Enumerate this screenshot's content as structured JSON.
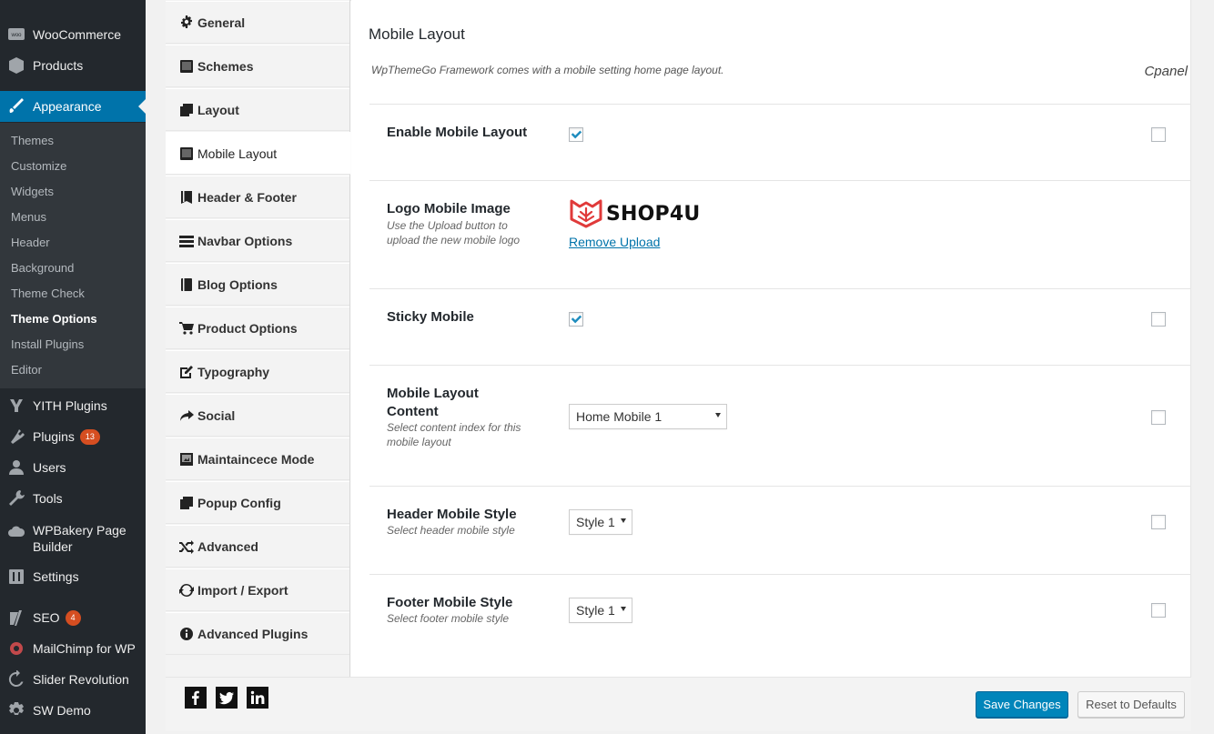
{
  "admin_menu": {
    "items_top": [
      {
        "label": "WooCommerce",
        "icon": "woo-icon"
      },
      {
        "label": "Products",
        "icon": "box-icon"
      },
      {
        "label": "Appearance",
        "icon": "paintbrush-icon"
      }
    ],
    "submenu": [
      "Themes",
      "Customize",
      "Widgets",
      "Menus",
      "Header",
      "Background",
      "Theme Check",
      "Theme Options",
      "Install Plugins",
      "Editor"
    ],
    "current_submenu": "Theme Options",
    "items_bottom": [
      {
        "label": "YITH Plugins",
        "icon": "yith-icon"
      },
      {
        "label": "Plugins",
        "icon": "plug-icon",
        "badge": "13"
      },
      {
        "label": "Users",
        "icon": "user-icon"
      },
      {
        "label": "Tools",
        "icon": "wrench-icon"
      },
      {
        "label_line1": "WPBakery Page",
        "label_line2": "Builder",
        "icon": "cloud-icon"
      },
      {
        "label": "Settings",
        "icon": "settings-sliders-icon"
      },
      {
        "label": "SEO",
        "icon": "yoast-icon",
        "badge": "4"
      },
      {
        "label": "MailChimp for WP",
        "icon": "mailchimp-icon"
      },
      {
        "label": "Slider Revolution",
        "icon": "refresh-icon"
      },
      {
        "label": "SW Demo",
        "icon": "gear-icon"
      }
    ]
  },
  "options_tabs": [
    {
      "label": "General",
      "icon": "cog-icon"
    },
    {
      "label": "Schemes",
      "icon": "monitor-icon"
    },
    {
      "label": "Layout",
      "icon": "copy-icon"
    },
    {
      "label": "Mobile Layout",
      "icon": "tablet-icon",
      "active": true
    },
    {
      "label": "Header & Footer",
      "icon": "book-icon"
    },
    {
      "label": "Navbar Options",
      "icon": "bars-icon"
    },
    {
      "label": "Blog Options",
      "icon": "book-icon"
    },
    {
      "label": "Product Options",
      "icon": "cart-icon"
    },
    {
      "label": "Typography",
      "icon": "edit-icon"
    },
    {
      "label": "Social",
      "icon": "share-icon"
    },
    {
      "label": "Maintaincece Mode",
      "icon": "image-icon"
    },
    {
      "label": "Popup Config",
      "icon": "copy-icon"
    },
    {
      "label": "Advanced",
      "icon": "shuffle-icon"
    },
    {
      "label": "Import / Export",
      "icon": "refresh-icon"
    },
    {
      "label": "Advanced Plugins",
      "icon": "info-icon"
    }
  ],
  "section": {
    "title": "Mobile Layout",
    "description": "WpThemeGo Framework comes with a mobile setting home page layout.",
    "cpanel_label": "Cpanel"
  },
  "fields": {
    "enable_mobile_layout": {
      "title": "Enable Mobile Layout",
      "checked": true
    },
    "logo_mobile_image": {
      "title": "Logo Mobile Image",
      "subtitle_line1": "Use the Upload button to",
      "subtitle_line2": "upload the new mobile logo",
      "logo_text": "SHOP4U",
      "remove_label": "Remove Upload"
    },
    "sticky_mobile": {
      "title": "Sticky Mobile",
      "checked": true
    },
    "mobile_layout_content": {
      "title_line1": "Mobile Layout",
      "title_line2": "Content",
      "subtitle_line1": "Select content index for this",
      "subtitle_line2": "mobile layout",
      "selected": "Home Mobile 1"
    },
    "header_mobile_style": {
      "title": "Header Mobile Style",
      "subtitle": "Select header mobile style",
      "selected": "Style 1"
    },
    "footer_mobile_style": {
      "title": "Footer Mobile Style",
      "subtitle": "Select footer mobile style",
      "selected": "Style 1"
    }
  },
  "footer": {
    "social": [
      "facebook-icon",
      "twitter-icon",
      "linkedin-icon"
    ],
    "save_label": "Save Changes",
    "reset_label": "Reset to Defaults"
  },
  "colors": {
    "admin_bg": "#23282d",
    "admin_active": "#0073aa",
    "badge": "#d54e21",
    "primary_button": "#0085ba",
    "checkbox_check": "#1e8cbe",
    "logo_red": "#e03a3a"
  }
}
